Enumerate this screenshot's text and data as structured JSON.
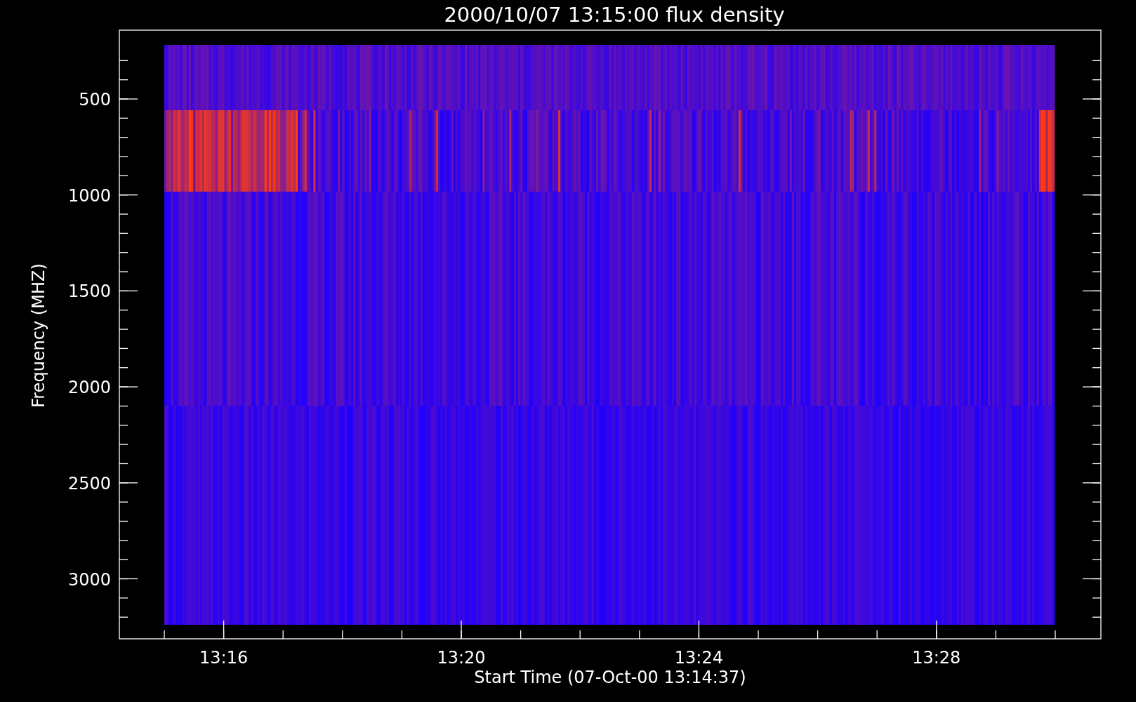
{
  "title": "2000/10/07 13:15:00 flux density",
  "y_axis": {
    "label": "Frequency (MHZ)",
    "tick_labels": [
      "500",
      "1000",
      "1500",
      "2000",
      "2500",
      "3000"
    ]
  },
  "x_axis": {
    "label": "Start Time (07-Oct-00 13:14:37)",
    "tick_labels": [
      "13:16",
      "13:20",
      "13:24",
      "13:28"
    ]
  }
}
